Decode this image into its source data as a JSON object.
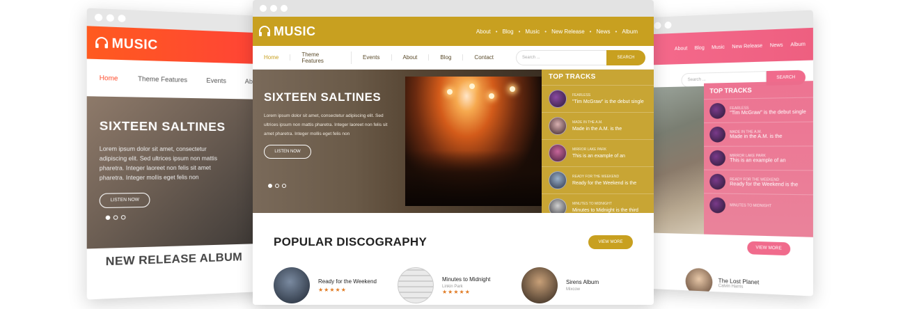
{
  "left_window": {
    "brand": "MUSIC",
    "nav": [
      "Home",
      "Theme Features",
      "Events",
      "Abo"
    ],
    "hero_title": "SIXTEEN SALTINES",
    "hero_text": "Lorem ipsum dolor sit amet, consectetur adipiscing elit. Sed ultrices ipsum non mattis pharetra. Integer laoreet non felis sit amet pharetra. Integer mollis eget felis non",
    "listen_label": "LISTEN NOW",
    "section_title": "NEW RELEASE ALBUM",
    "accent_color": "#ff4b2b"
  },
  "center_window": {
    "brand": "MUSIC",
    "top_nav": [
      "About",
      "Blog",
      "Music",
      "New Release",
      "News",
      "Album"
    ],
    "nav": [
      "Home",
      "Theme Features",
      "Events",
      "About",
      "Blog",
      "Contact"
    ],
    "search_placeholder": "Search ...",
    "search_button": "SEARCH",
    "hero_title": "SIXTEEN SALTINES",
    "hero_text": "Lorem ipsum dolor sit amet, consectetur adipiscing elit. Sed ultrices ipsum non mattis pharetra. Integer laoreet non felis sit amet pharetra. Integer mollis eget felis non",
    "listen_label": "LISTEN NOW",
    "top_tracks_title": "TOP TRACKS",
    "tracks": [
      {
        "meta": "FEARLESS",
        "title": "\"Tim McGraw\" is the debut single"
      },
      {
        "meta": "MADE IN THE A.M.",
        "title": "Made in the A.M. is the"
      },
      {
        "meta": "MIRROR LAKE PARK",
        "title": "This is an example of an"
      },
      {
        "meta": "READY FOR THE WEEKEND",
        "title": "Ready for the Weekend is the"
      },
      {
        "meta": "MINUTES TO MIDNIGHT",
        "title": "Minutes to Midnight is the third"
      }
    ],
    "discography_title": "POPULAR DISCOGRAPHY",
    "view_more": "VIEW MORE",
    "albums": [
      {
        "title": "Ready for the Weekend",
        "sub": "",
        "stars": "★★★★★"
      },
      {
        "title": "Minutes to Midnight",
        "sub": "Linkin Park",
        "stars": "★★★★★"
      },
      {
        "title": "Sirens Album",
        "sub": "Mixcow",
        "stars": ""
      }
    ],
    "accent_color": "#c8a020"
  },
  "right_window": {
    "top_nav": [
      "About",
      "Blog",
      "Music",
      "New Release",
      "News",
      "Album"
    ],
    "search_placeholder": "Search ...",
    "search_button": "SEARCH",
    "top_tracks_title": "TOP TRACKS",
    "tracks": [
      {
        "meta": "FEARLESS",
        "title": "\"Tim McGraw\" is the debut single"
      },
      {
        "meta": "MADE IN THE A.M.",
        "title": "Made in the A.M. is the"
      },
      {
        "meta": "MIRROR LAKE PARK",
        "title": "This is an example of an"
      },
      {
        "meta": "READY FOR THE WEEKEND",
        "title": "Ready for the Weekend is the"
      },
      {
        "meta": "MINUTES TO MIDNIGHT",
        "title": ""
      }
    ],
    "view_more": "VIEW MORE",
    "album_title": "The Lost Planet",
    "album_sub": "Calvin Harris",
    "accent_color": "#f06b8c"
  }
}
